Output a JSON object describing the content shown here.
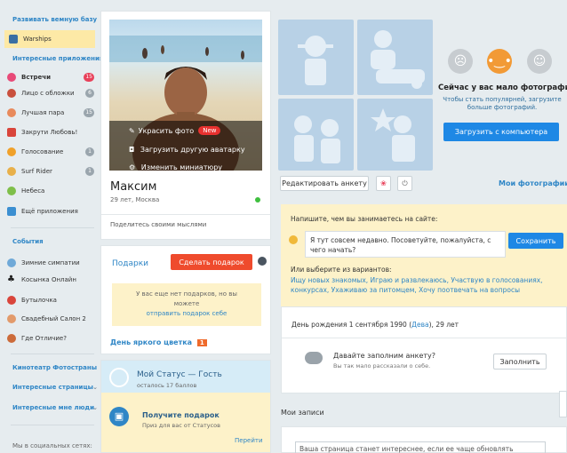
{
  "sidebar": {
    "develop_title": "Развивать вемную базу",
    "warships": "Warships",
    "apps_title": "Интересные приложения",
    "apps": [
      {
        "label": "Встречи",
        "badge": "15",
        "color": "#e8415a"
      },
      {
        "label": "Лицо с обложки",
        "badge": "6",
        "color": "#9aa5ad"
      },
      {
        "label": "Лучшая пара",
        "badge": "15",
        "color": "#9aa5ad"
      },
      {
        "label": "Закрути Любовь!",
        "badge": "",
        "color": ""
      },
      {
        "label": "Голосование",
        "badge": "1",
        "color": "#9aa5ad"
      },
      {
        "label": "Surf Rider",
        "badge": "1",
        "color": "#9aa5ad"
      },
      {
        "label": "Небеса",
        "badge": "",
        "color": ""
      },
      {
        "label": "Ещё приложения",
        "badge": "",
        "color": ""
      }
    ],
    "events_title": "События",
    "events": [
      "Зимние симпатии",
      "Косынка Онлайн",
      "Бутылочка",
      "Свадебный Салон 2",
      "Где Отличие?"
    ],
    "theatre": "Кинотеатр Фотостраны",
    "pages": "Интересные страницы",
    "people": "Интересные мне люди",
    "social": "Мы в социальных сетях:"
  },
  "profile": {
    "decorate": "Украсить фото",
    "new_badge": "New",
    "upload_avatar": "Загрузить другую аватарку",
    "change_thumb": "Изменить миниатюру",
    "name": "Максим",
    "info": "29 лет, Москва",
    "share": "Поделитесь своими мыслями"
  },
  "gifts": {
    "title": "Подарки",
    "make_gift": "Сделать подарок",
    "empty1": "У вас еще нет подарков, но вы",
    "empty2": "можете",
    "send_link": "отправить подарок себе",
    "flower_day": "День яркого цветка",
    "flower_badge": "1"
  },
  "status": {
    "title": "Мой Статус — Гость",
    "points": "осталось 17 баллов",
    "gift_title": "Получите подарок",
    "gift_sub": "Приз для вас от Статусов",
    "next": "Перейти"
  },
  "photos": {
    "few_title": "Сейчас у вас мало фотографий.",
    "few_sub1": "Чтобы стать популярней, загрузите",
    "few_sub2": "больше фотографий.",
    "upload": "Загрузить с компьютера",
    "edit": "Редактировать анкету",
    "my_photos": "Мои фотографии"
  },
  "question": {
    "prompt": "Напишите, чем вы занимаетесь на сайте:",
    "answer": "Я тут совсем недавно. Посоветуйте, пожалуйста, с чего начать?",
    "save": "Сохранить",
    "or_choose": "Или выберите из вариантов:",
    "options_line1": "Ищу новых знакомых, Играю и развлекаюсь, Участвую в голосованиях,",
    "options_line2": "конкурсах, Ухаживаю за питомцем, Хочу поотвечать на вопросы"
  },
  "birthday": {
    "prefix": "День рождения 1 сентября 1990 (",
    "sign": "Дева",
    "suffix": "), 29 лет"
  },
  "fill": {
    "title": "Давайте заполним анкету?",
    "sub": "Вы так мало рассказали о себе.",
    "button": "Заполнить"
  },
  "posts": {
    "title": "Мои записи",
    "placeholder": "Ваша страница станет интереснее, если ее чаще обновлять"
  }
}
